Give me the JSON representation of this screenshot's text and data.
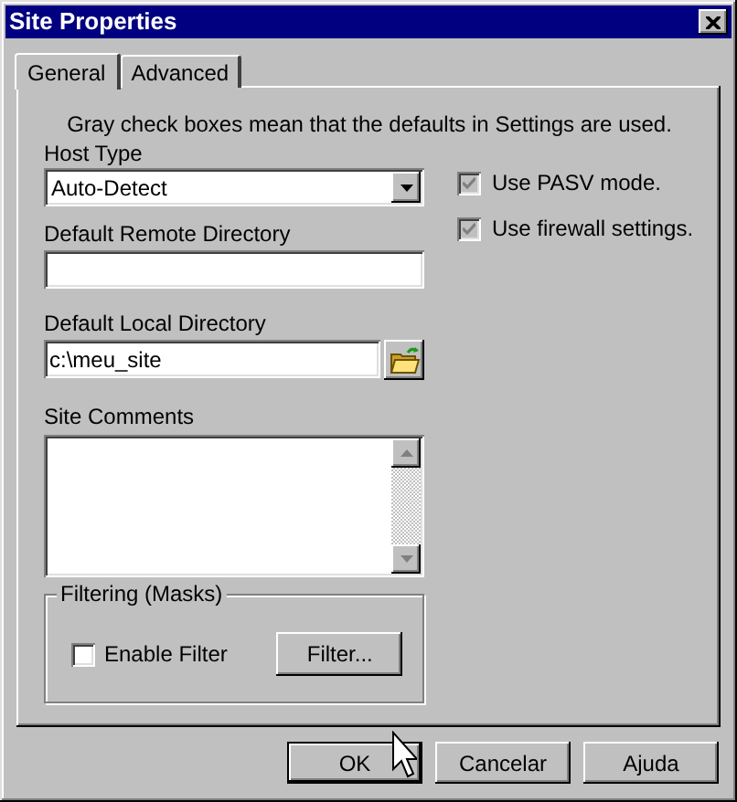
{
  "window": {
    "title": "Site Properties"
  },
  "tabs": [
    {
      "label": "General",
      "selected": true
    },
    {
      "label": "Advanced",
      "selected": false
    }
  ],
  "note": "Gray check boxes mean that the defaults in Settings are used.",
  "host_type": {
    "label": "Host Type",
    "value": "Auto-Detect"
  },
  "remote_directory": {
    "label": "Default Remote Directory"
  },
  "local_directory": {
    "label": "Default Local Directory",
    "value": "c:\\meu_site"
  },
  "site_comments": {
    "label": "Site Comments"
  },
  "options": [
    {
      "label": "Use PASV mode.",
      "checked": true,
      "grayed": true
    },
    {
      "label": "Use firewall settings.",
      "checked": true,
      "grayed": true
    }
  ],
  "filtering": {
    "title": "Filtering (Masks)",
    "enable_filter": {
      "label": "Enable Filter",
      "checked": false
    },
    "filter_button": {
      "label": "Filter..."
    }
  },
  "buttons": [
    {
      "label": "OK",
      "default": true
    },
    {
      "label": "Cancelar",
      "default": false
    },
    {
      "label": "Ajuda",
      "default": false
    }
  ]
}
